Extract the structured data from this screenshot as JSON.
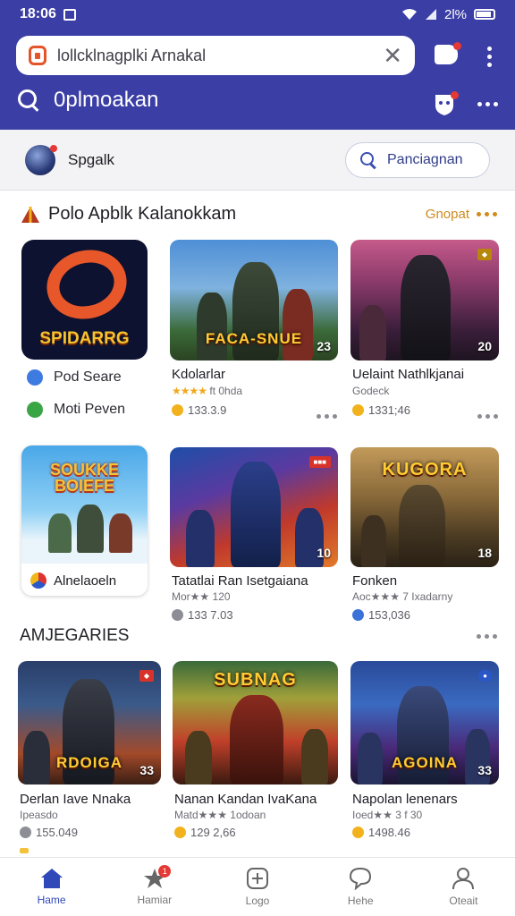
{
  "status": {
    "time": "18:06",
    "battery": "2l%"
  },
  "browser": {
    "url": "lollcklnagplki Arnakal"
  },
  "header": {
    "title": "0plmoakan"
  },
  "user": {
    "name": "Spgalk",
    "search_label": "Panciagnan"
  },
  "section1": {
    "title": "Polo Apblk  Kalanokkam",
    "more_label": "Gnopat",
    "featured": {
      "name": "SPIDARRG",
      "perm1": "Pod Seare",
      "perm2": "Moti Peven"
    },
    "cards": [
      {
        "art_title": "FACA-SNUE",
        "badge_num": "23",
        "name": "Kdolarlar",
        "sub": "ft 0hda",
        "count": "133.3.9",
        "coin": "gold"
      },
      {
        "art_title": "",
        "badge_num": "20",
        "name": "Uelaint Nathlkjanai",
        "sub": "Godeck",
        "count": "1331;46",
        "coin": "gold"
      },
      {
        "art_title": "",
        "badge_num": "10",
        "name": "Tatatlai Ran Isetgaiana",
        "sub": "Mor★★ 120",
        "count": "133 7.03",
        "coin": "gray"
      },
      {
        "art_title": "KUGORA",
        "badge_num": "18",
        "name": "Fonken",
        "sub": "Aoc★★★ 7 Ixadarny",
        "count": "153,036",
        "coin": "blue"
      }
    ],
    "square_card": {
      "logo": "SOUKKE BOIEFE",
      "name": "Alnelaoeln"
    }
  },
  "section2": {
    "title": "AMJEGARIES",
    "cards": [
      {
        "art_title": "RDOIGA",
        "badge_num": "33",
        "name": "Derlan  Iave Nnaka",
        "sub": "Ipeasdo",
        "count": "155.049",
        "coin": "gray"
      },
      {
        "art_title": "SUBNAG",
        "badge_num": "",
        "name": "Nanan Kandan IvaKana",
        "sub": "Matd★★★ 1odoan",
        "count": "129 2,66",
        "coin": "gold"
      },
      {
        "art_title": "AGOINA",
        "badge_num": "33",
        "name": "Napolan lenenars",
        "sub": "Ioed★★ 3 f 30",
        "count": "1498.46",
        "coin": "gold"
      }
    ]
  },
  "nav": [
    {
      "label": "Hame",
      "icon": "home-icon",
      "active": true
    },
    {
      "label": "Hamiar",
      "icon": "star-icon",
      "badge": "1"
    },
    {
      "label": "Logo",
      "icon": "add-icon"
    },
    {
      "label": "Hehe",
      "icon": "chat-icon"
    },
    {
      "label": "Oteait",
      "icon": "profile-icon"
    }
  ],
  "colors": {
    "header": "#3a3ea5",
    "accent": "#3049b8",
    "star": "#f0a91c",
    "more": "#d08a1e"
  }
}
